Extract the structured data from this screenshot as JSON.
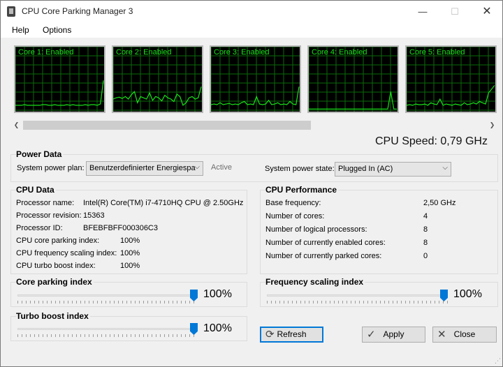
{
  "window": {
    "title": "CPU Core Parking Manager 3",
    "minimize": "—",
    "maximize": "☐",
    "close": "✕"
  },
  "menu": {
    "help": "Help",
    "options": "Options"
  },
  "cores": [
    {
      "label": "Core 1: Enabled",
      "load": [
        8,
        8,
        8,
        9,
        8,
        8,
        8,
        8,
        8,
        9,
        9,
        8,
        8,
        9,
        8,
        8,
        8,
        9,
        8,
        9,
        8,
        8,
        8,
        9,
        8,
        9,
        9,
        8,
        10,
        48
      ]
    },
    {
      "label": "Core 2: Enabled",
      "load": [
        18,
        20,
        21,
        19,
        22,
        18,
        25,
        30,
        12,
        22,
        20,
        18,
        28,
        16,
        22,
        20,
        15,
        24,
        20,
        18,
        14,
        26,
        22,
        8,
        12,
        20,
        22,
        18,
        20,
        38
      ]
    },
    {
      "label": "Core 3: Enabled",
      "load": [
        9,
        10,
        9,
        12,
        9,
        10,
        11,
        9,
        10,
        9,
        12,
        14,
        9,
        10,
        9,
        22,
        10,
        9,
        10,
        16,
        9,
        10,
        12,
        9,
        10,
        9,
        14,
        10,
        9,
        38
      ]
    },
    {
      "label": "Core 4: Enabled",
      "load": [
        2,
        2,
        2,
        2,
        2,
        2,
        2,
        2,
        2,
        2,
        2,
        2,
        2,
        2,
        2,
        2,
        2,
        2,
        2,
        2,
        2,
        2,
        2,
        2,
        2,
        2,
        2,
        30,
        2,
        2
      ]
    },
    {
      "label": "Core 5: Enabled",
      "load": [
        8,
        9,
        8,
        10,
        9,
        9,
        10,
        8,
        12,
        10,
        9,
        18,
        8,
        10,
        9,
        8,
        10,
        9,
        8,
        12,
        9,
        10,
        12,
        10,
        14,
        12,
        10,
        28,
        34,
        40
      ]
    }
  ],
  "cpu_speed": {
    "label": "CPU Speed:",
    "value": "0,79 GHz"
  },
  "power": {
    "title": "Power Data",
    "plan_label": "System power plan:",
    "plan_value": "Benutzerdefinierter Energiespa",
    "plan_status": "Active",
    "state_label": "System power state:",
    "state_value": "Plugged In (AC)"
  },
  "cpu_data": {
    "title": "CPU Data",
    "rows": [
      {
        "label": "Processor name:",
        "value": "Intel(R) Core(TM) i7-4710HQ CPU @ 2.50GHz"
      },
      {
        "label": "Processor revision:",
        "value": "15363"
      },
      {
        "label": "Processor ID:",
        "value": "BFEBFBFF000306C3"
      },
      {
        "label": "CPU core parking index:",
        "value": "100%"
      },
      {
        "label": "CPU frequency scaling index:",
        "value": "100%"
      },
      {
        "label": "CPU turbo boost index:",
        "value": "100%"
      }
    ]
  },
  "cpu_perf": {
    "title": "CPU Performance",
    "rows": [
      {
        "label": "Base frequency:",
        "value": "2,50 GHz"
      },
      {
        "label": "Number of cores:",
        "value": "4"
      },
      {
        "label": "Number of logical processors:",
        "value": "8"
      },
      {
        "label": "Number of currently enabled cores:",
        "value": "8"
      },
      {
        "label": "Number of currently parked cores:",
        "value": "0"
      }
    ]
  },
  "sliders": {
    "core_parking": {
      "title": "Core parking index",
      "value": "100%",
      "level": 1.0
    },
    "freq_scaling": {
      "title": "Frequency scaling index",
      "value": "100%",
      "level": 1.0
    },
    "turbo_boost": {
      "title": "Turbo boost index",
      "value": "100%",
      "level": 1.0
    }
  },
  "buttons": {
    "refresh": "Refresh",
    "apply": "Apply",
    "close": "Close"
  },
  "colors": {
    "graph_bg": "#000000",
    "graph_line": "#19e119",
    "grid": "#0a6b0a",
    "accent": "#0078d7"
  }
}
